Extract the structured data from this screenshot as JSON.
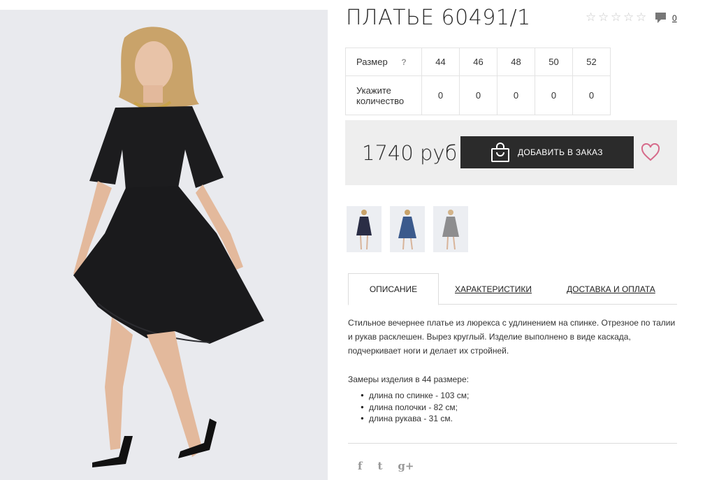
{
  "product": {
    "title": "ПЛАТЬЕ 60491/1",
    "rating_stars": 0,
    "rating_max": 5,
    "comments_count": "0"
  },
  "sizes": {
    "size_label": "Размер",
    "help_symbol": "?",
    "qty_label_line1": "Укажите",
    "qty_label_line2": "количество",
    "columns": [
      {
        "size": "44",
        "qty": "0"
      },
      {
        "size": "46",
        "qty": "0"
      },
      {
        "size": "48",
        "qty": "0"
      },
      {
        "size": "50",
        "qty": "0"
      },
      {
        "size": "52",
        "qty": "0"
      }
    ]
  },
  "purchase": {
    "price": "1740 руб",
    "add_button_label": "ДОБАВИТЬ В ЗАКАЗ"
  },
  "thumbnails": [
    {
      "icon": "dress-thumbnail-dark"
    },
    {
      "icon": "dress-thumbnail-blue"
    },
    {
      "icon": "dress-thumbnail-grey"
    }
  ],
  "tabs": [
    {
      "label": "ОПИСАНИЕ",
      "active": true
    },
    {
      "label": "ХАРАКТЕРИСТИКИ",
      "active": false
    },
    {
      "label": "ДОСТАВКА И ОПЛАТА",
      "active": false
    }
  ],
  "description": {
    "text": "Стильное вечернее платье из люрекса с удлинением на спинке. Отрезное по талии и рукав расклешен. Вырез круглый. Изделие выполнено в виде каскада, подчеркивает ноги и делает их стройней.",
    "measure_title": "Замеры изделия в 44 размере:",
    "measures": [
      "длина по спинке - 103 см;",
      "длина полочки - 82 см;",
      "длина рукава - 31 см."
    ]
  },
  "social": {
    "facebook": "f",
    "twitter": "t",
    "googleplus": "g+"
  },
  "colors": {
    "button_bg": "#2b2b2b",
    "heart": "#d66a8a",
    "buy_box_bg": "#eeeeee"
  }
}
